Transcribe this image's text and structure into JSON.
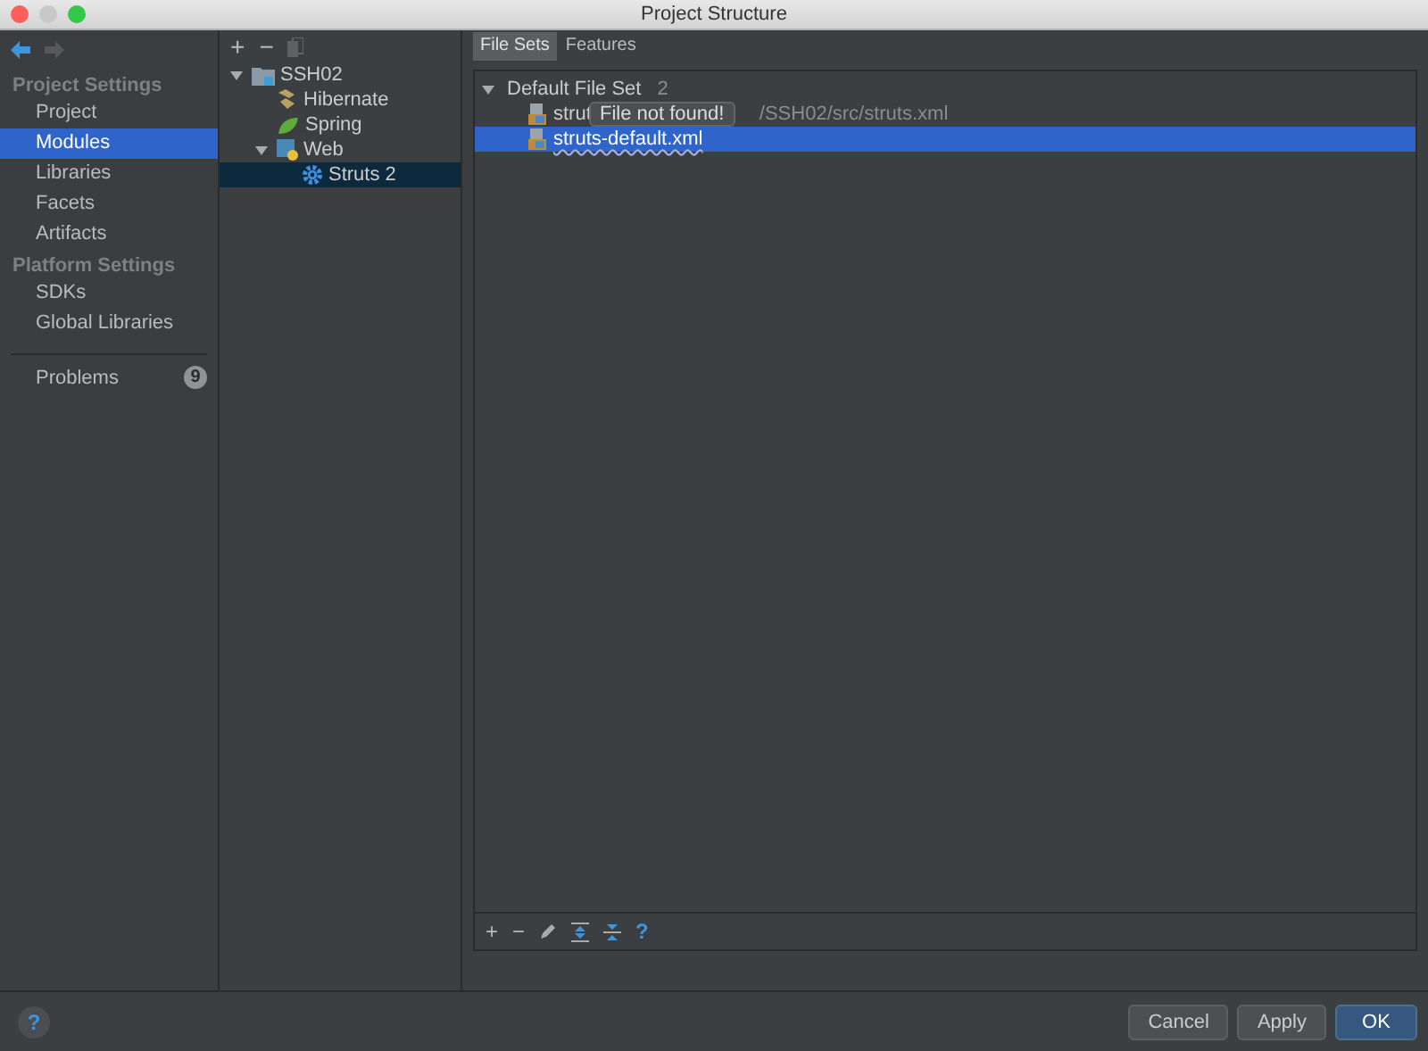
{
  "window": {
    "title": "Project Structure"
  },
  "sidebar": {
    "sections": [
      {
        "title": "Project Settings",
        "items": [
          {
            "label": "Project",
            "selected": false
          },
          {
            "label": "Modules",
            "selected": true
          },
          {
            "label": "Libraries",
            "selected": false
          },
          {
            "label": "Facets",
            "selected": false
          },
          {
            "label": "Artifacts",
            "selected": false
          }
        ]
      },
      {
        "title": "Platform Settings",
        "items": [
          {
            "label": "SDKs",
            "selected": false
          },
          {
            "label": "Global Libraries",
            "selected": false
          }
        ]
      }
    ],
    "problems": {
      "label": "Problems",
      "count": "9"
    }
  },
  "tree_toolbar": [
    "+",
    "−"
  ],
  "tree": {
    "items": [
      {
        "label": "SSH02",
        "kind": "module",
        "expanded": true,
        "selected": false,
        "children": [
          {
            "label": "Hibernate",
            "kind": "hibernate",
            "selected": false
          },
          {
            "label": "Spring",
            "kind": "spring",
            "selected": false
          },
          {
            "label": "Web",
            "kind": "web",
            "expanded": true,
            "selected": false,
            "children": [
              {
                "label": "Struts 2",
                "kind": "struts",
                "selected": true
              }
            ]
          }
        ]
      }
    ]
  },
  "tabs": [
    {
      "label": "File Sets",
      "selected": true
    },
    {
      "label": "Features",
      "selected": false
    }
  ],
  "file_sets": {
    "group": {
      "label": "Default File Set",
      "count": "2",
      "expanded": true
    },
    "files": [
      {
        "name": "strut",
        "path": "/SSH02/src/struts.xml",
        "selected": false,
        "missing": false
      },
      {
        "name": "struts-default.xml",
        "selected": true,
        "missing": true
      }
    ],
    "tooltip": "File not found!",
    "toolbar": {
      "add": "+",
      "remove": "−",
      "help": "?"
    }
  },
  "help_button": "?",
  "buttons": [
    {
      "label": "Cancel",
      "kind": "normal"
    },
    {
      "label": "Apply",
      "kind": "normal"
    },
    {
      "label": "OK",
      "kind": "default"
    }
  ]
}
